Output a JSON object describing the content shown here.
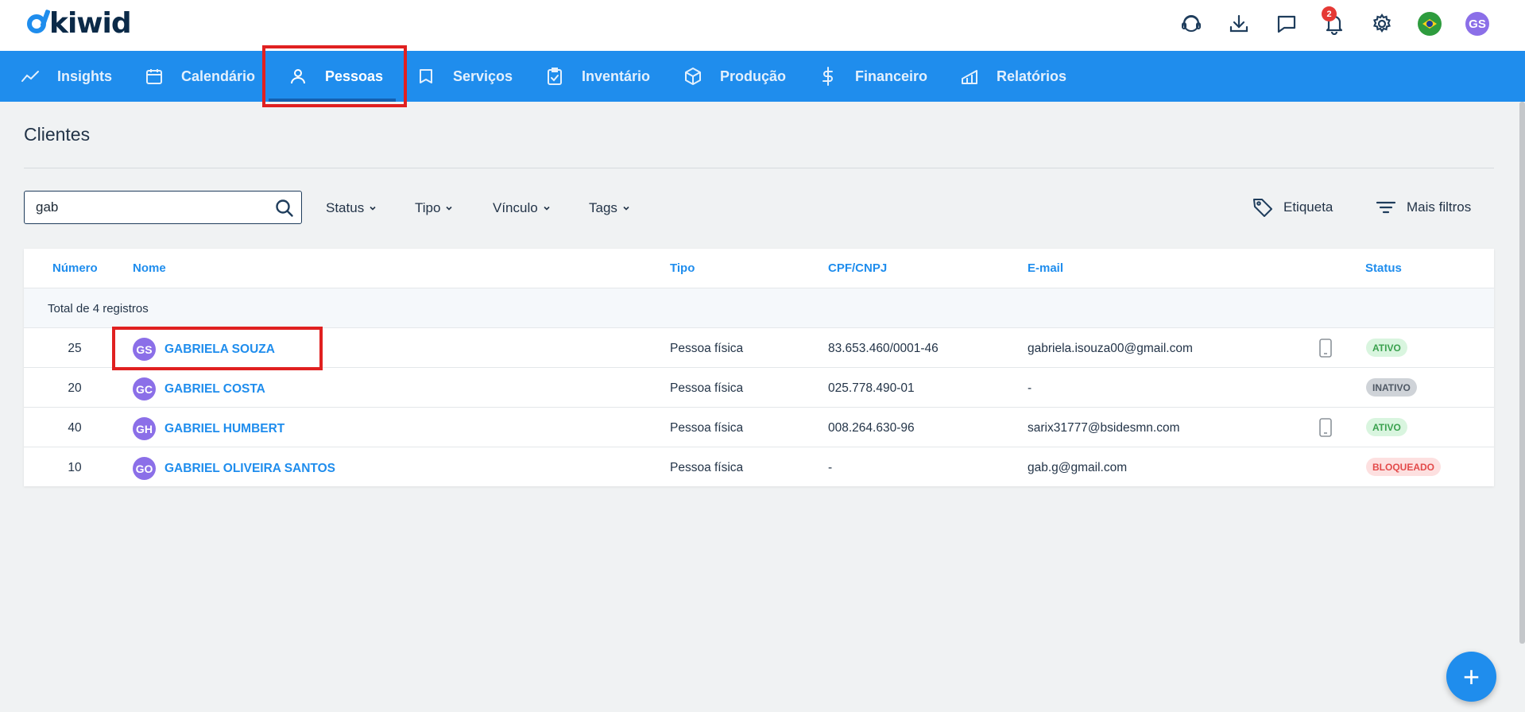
{
  "app": {
    "logo_text": "kiwid",
    "notification_count": "2",
    "user_initials": "GS"
  },
  "top_icons": [
    "headset-icon",
    "download-icon",
    "chat-icon",
    "bell-icon",
    "gear-icon",
    "brazil-flag-icon",
    "user-avatar"
  ],
  "nav": {
    "items": [
      {
        "label": "Insights",
        "icon": "chart-line-icon"
      },
      {
        "label": "Calendário",
        "icon": "calendar-icon"
      },
      {
        "label": "Pessoas",
        "icon": "person-icon",
        "active": true
      },
      {
        "label": "Serviços",
        "icon": "tooth-icon"
      },
      {
        "label": "Inventário",
        "icon": "clipboard-check-icon"
      },
      {
        "label": "Produção",
        "icon": "box-icon"
      },
      {
        "label": "Financeiro",
        "icon": "dollar-icon"
      },
      {
        "label": "Relatórios",
        "icon": "report-chart-icon"
      }
    ]
  },
  "page": {
    "title": "Clientes"
  },
  "search": {
    "value": "gab",
    "placeholder": ""
  },
  "filters": [
    {
      "label": "Status"
    },
    {
      "label": "Tipo"
    },
    {
      "label": "Vínculo"
    },
    {
      "label": "Tags"
    }
  ],
  "actions": {
    "etiqueta": "Etiqueta",
    "mais_filtros": "Mais filtros"
  },
  "table": {
    "columns": [
      "Número",
      "Nome",
      "Tipo",
      "CPF/CNPJ",
      "E-mail",
      "Status"
    ],
    "total_text": "Total de 4 registros",
    "rows": [
      {
        "numero": "25",
        "initials": "GS",
        "nome": "GABRIELA SOUZA",
        "tipo": "Pessoa física",
        "cpf": "83.653.460/0001-46",
        "email": "gabriela.isouza00@gmail.com",
        "has_phone": true,
        "status": "ATIVO"
      },
      {
        "numero": "20",
        "initials": "GC",
        "nome": "GABRIEL COSTA",
        "tipo": "Pessoa física",
        "cpf": "025.778.490-01",
        "email": "-",
        "has_phone": false,
        "status": "INATIVO"
      },
      {
        "numero": "40",
        "initials": "GH",
        "nome": "GABRIEL HUMBERT",
        "tipo": "Pessoa física",
        "cpf": "008.264.630-96",
        "email": "sarix31777@bsidesmn.com",
        "has_phone": true,
        "status": "ATIVO"
      },
      {
        "numero": "10",
        "initials": "GO",
        "nome": "GABRIEL OLIVEIRA SANTOS",
        "tipo": "Pessoa física",
        "cpf": "-",
        "email": "gab.g@gmail.com",
        "has_phone": false,
        "status": "BLOQUEADO"
      }
    ]
  },
  "status_colors": {
    "ATIVO": {
      "bg": "#d9f5df",
      "fg": "#3aa14e"
    },
    "INATIVO": {
      "bg": "#cfd3d8",
      "fg": "#4f5965"
    },
    "BLOQUEADO": {
      "bg": "#fde0e0",
      "fg": "#e34a4a"
    }
  },
  "fab": {
    "label": "+"
  },
  "colors": {
    "brand_blue": "#1f8ded",
    "avatar_purple": "#8b6fe8",
    "highlight_red": "#e02020"
  }
}
